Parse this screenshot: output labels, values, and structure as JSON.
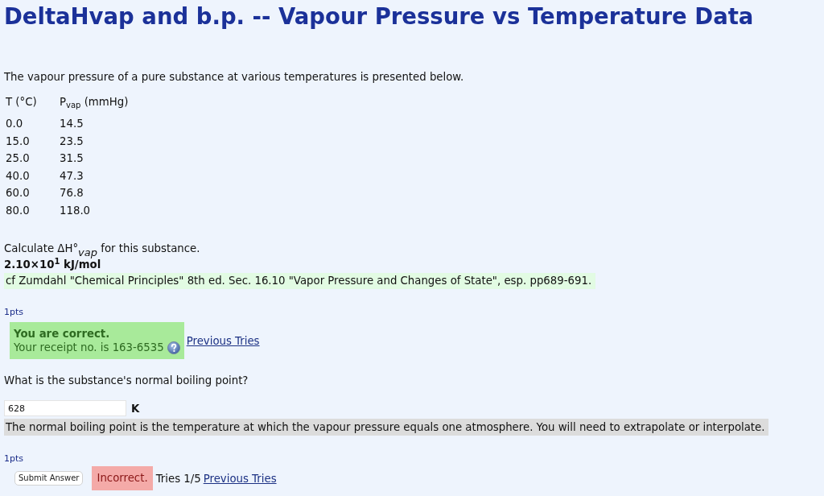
{
  "title": "DeltaHvap and b.p. -- Vapour Pressure vs Temperature Data",
  "intro": "The vapour pressure of a pure substance at various temperatures is presented below.",
  "table": {
    "columns": [
      "T (°C)",
      "P$_{vap}$ (mmHg)"
    ],
    "rows": [
      [
        "0.0",
        "14.5"
      ],
      [
        "15.0",
        "23.5"
      ],
      [
        "25.0",
        "31.5"
      ],
      [
        "40.0",
        "47.3"
      ],
      [
        "60.0",
        "76.8"
      ],
      [
        "80.0",
        "118.0"
      ]
    ]
  },
  "parts": [
    {
      "kind": "answered",
      "prompt": "Calculate ΔH°$_{vap}$ for this substance.",
      "answer": "2.10×10$^{1}$ kJ/mol",
      "reference": "cf Zumdahl \"Chemical Principles\" 8th ed. Sec. 16.10 \"Vapor Pressure and Changes of State\", esp. pp689-691.",
      "points": "1pts",
      "feedback": {
        "correct": true,
        "heading": "You are correct.",
        "text": "Your receipt no. is 163-6535"
      },
      "link": "Previous Tries"
    },
    {
      "kind": "input",
      "prompt": "What is the substance's normal boiling point?",
      "input": {
        "value": "628"
      },
      "unit": "K",
      "hint": "The normal boiling point is the temperature at which the vapour pressure equals one atmosphere. You will need to extrapolate or interpolate.",
      "points": "1pts",
      "submit": "Submit Answer",
      "feedback": {
        "correct": false,
        "text": "Incorrect."
      },
      "tries": "Tries 1/5",
      "link": "Previous Tries"
    }
  ]
}
